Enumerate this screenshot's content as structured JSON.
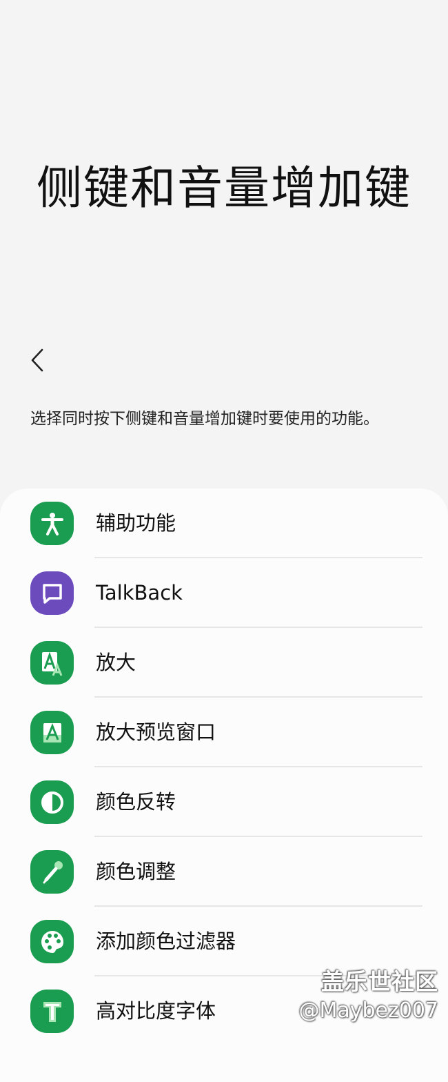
{
  "header": {
    "title": "侧键和音量增加键",
    "back_icon": "chevron-left-icon"
  },
  "description": "选择同时按下侧键和音量增加键时要使用的功能。",
  "colors": {
    "background": "#f4f4f4",
    "card": "#fcfcfc",
    "green": "#1a9d50",
    "purple": "#6c4cbd",
    "divider": "#e6e6e6"
  },
  "items": [
    {
      "label": "辅助功能",
      "icon": "accessibility-person-icon",
      "color": "#1a9d50"
    },
    {
      "label": "TalkBack",
      "icon": "speech-bubble-icon",
      "color": "#6c4cbd"
    },
    {
      "label": "放大",
      "icon": "magnify-letter-a-icon",
      "color": "#1a9d50"
    },
    {
      "label": "放大预览窗口",
      "icon": "magnifier-window-letter-a-icon",
      "color": "#1a9d50"
    },
    {
      "label": "颜色反转",
      "icon": "color-inversion-icon",
      "color": "#1a9d50"
    },
    {
      "label": "颜色调整",
      "icon": "eyedropper-icon",
      "color": "#1a9d50"
    },
    {
      "label": "添加颜色过滤器",
      "icon": "palette-icon",
      "color": "#1a9d50"
    },
    {
      "label": "高对比度字体",
      "icon": "letter-t-icon",
      "color": "#1a9d50"
    }
  ],
  "watermark": {
    "logo": "盖乐世社区",
    "user": "@Maybez007"
  }
}
